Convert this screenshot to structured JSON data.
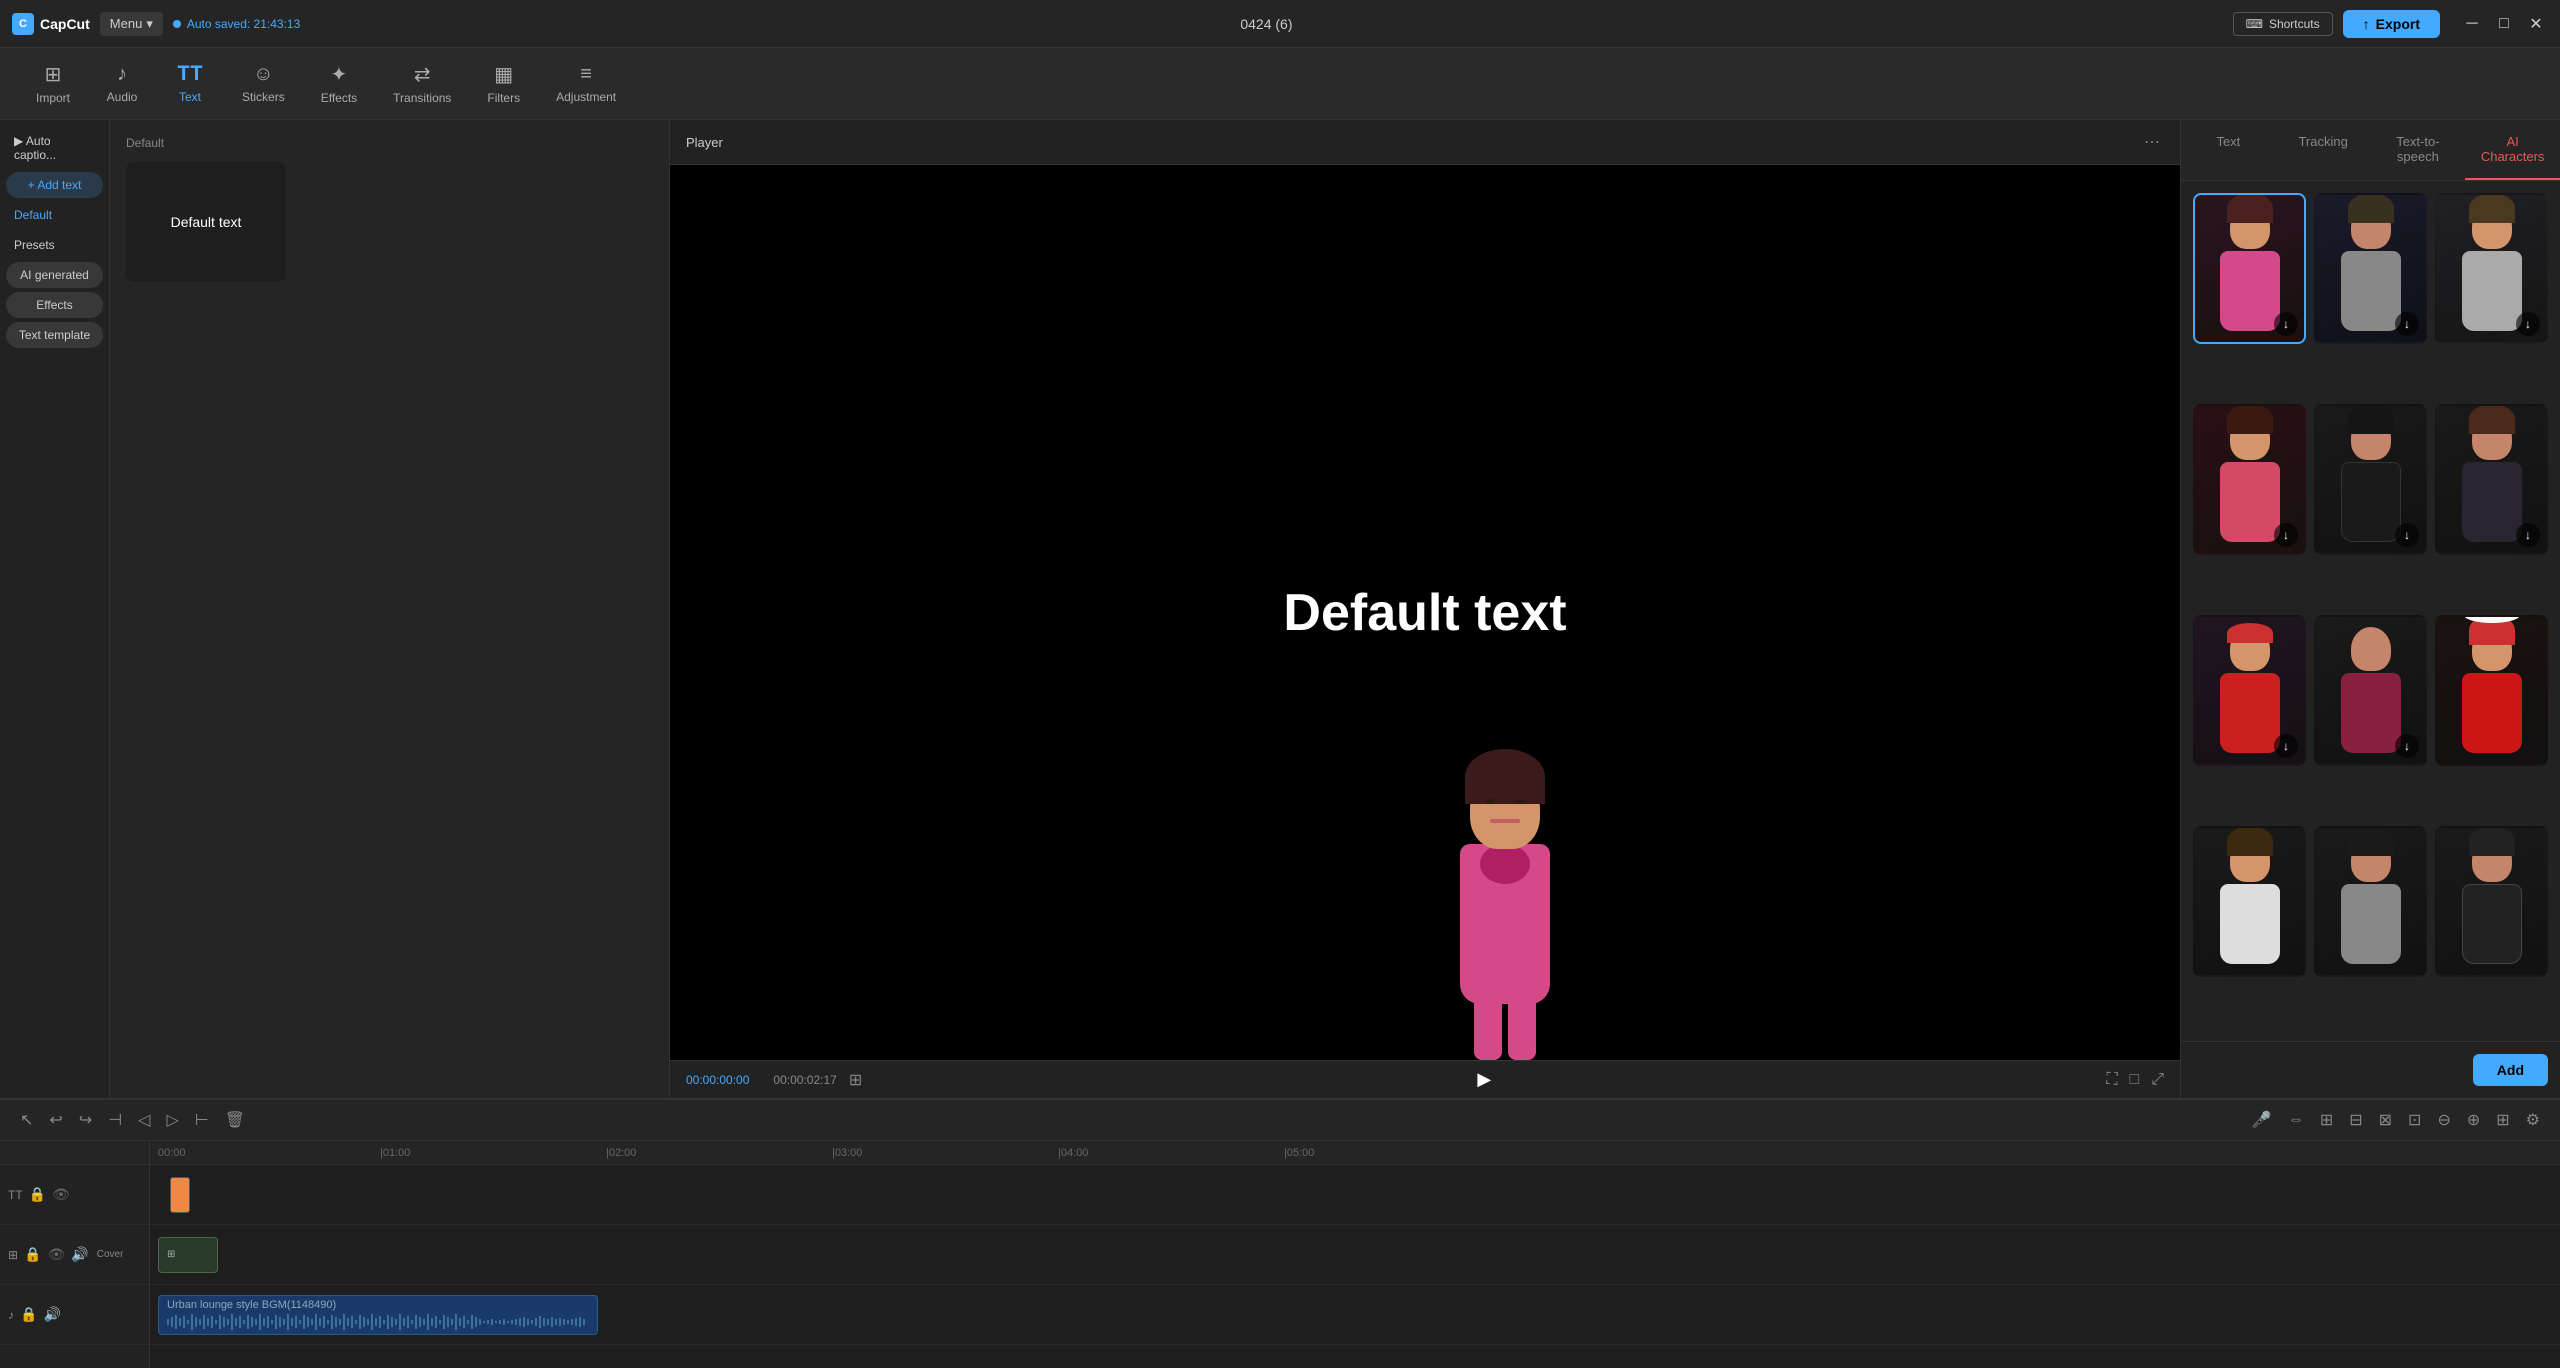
{
  "app": {
    "logo": "CapCut",
    "menu_label": "Menu",
    "autosave": "Auto saved: 21:43:13",
    "project_title": "0424 (6)"
  },
  "topbar": {
    "shortcuts_label": "Shortcuts",
    "export_label": "Export"
  },
  "toolbar": {
    "items": [
      {
        "id": "import",
        "label": "Import",
        "icon": "⊞"
      },
      {
        "id": "audio",
        "label": "Audio",
        "icon": "♪"
      },
      {
        "id": "text",
        "label": "Text",
        "icon": "T",
        "active": true
      },
      {
        "id": "stickers",
        "label": "Stickers",
        "icon": "☺"
      },
      {
        "id": "effects",
        "label": "Effects",
        "icon": "✦"
      },
      {
        "id": "transitions",
        "label": "Transitions",
        "icon": "⇄"
      },
      {
        "id": "filters",
        "label": "Filters",
        "icon": "▦"
      },
      {
        "id": "adjustment",
        "label": "Adjustment",
        "icon": "≡"
      }
    ]
  },
  "left_panel": {
    "items": [
      {
        "id": "auto-caption",
        "label": "▶ Auto captio...",
        "type": "link"
      },
      {
        "id": "add-text",
        "label": "+ Add text",
        "type": "pill",
        "active": true
      },
      {
        "id": "default",
        "label": "Default",
        "type": "plain",
        "active": true
      },
      {
        "id": "presets",
        "label": "Presets",
        "type": "plain"
      },
      {
        "id": "ai-generated",
        "label": "AI generated",
        "type": "pill"
      },
      {
        "id": "effects",
        "label": "Effects",
        "type": "pill"
      },
      {
        "id": "text-template",
        "label": "Text template",
        "type": "pill"
      }
    ]
  },
  "text_panel": {
    "section": "Default",
    "card_label": "Default text"
  },
  "player": {
    "title": "Player",
    "time_current": "00:00:00:00",
    "time_total": "00:00:02:17",
    "overlay_text": "Default text"
  },
  "right_panel": {
    "tabs": [
      {
        "id": "text",
        "label": "Text"
      },
      {
        "id": "tracking",
        "label": "Tracking"
      },
      {
        "id": "text-to-speech",
        "label": "Text-to-speech"
      },
      {
        "id": "ai-characters",
        "label": "AI Characters",
        "active": true
      }
    ],
    "add_button": "Add",
    "characters": [
      {
        "id": "char-1",
        "selected": true,
        "bg": "#3a1a2a",
        "emoji": "👩"
      },
      {
        "id": "char-2",
        "selected": false,
        "bg": "#2a2a3a",
        "emoji": "👩"
      },
      {
        "id": "char-3",
        "selected": false,
        "bg": "#252530",
        "emoji": "👩"
      },
      {
        "id": "char-4",
        "selected": false,
        "bg": "#3a1a2a",
        "emoji": "👩"
      },
      {
        "id": "char-5",
        "selected": false,
        "bg": "#2a2a2a",
        "emoji": "👩"
      },
      {
        "id": "char-6",
        "selected": false,
        "bg": "#1a1a1a",
        "emoji": "👩"
      },
      {
        "id": "char-7",
        "selected": false,
        "bg": "#2a1a1a",
        "emoji": "👩"
      },
      {
        "id": "char-8",
        "selected": false,
        "bg": "#252525",
        "emoji": "👩"
      },
      {
        "id": "char-9",
        "selected": false,
        "bg": "#2a2a2a",
        "emoji": "🧑"
      },
      {
        "id": "char-10",
        "selected": false,
        "bg": "#1a1a1a",
        "emoji": "👩"
      },
      {
        "id": "char-11",
        "selected": false,
        "bg": "#282828",
        "emoji": "🧑"
      },
      {
        "id": "char-12",
        "selected": false,
        "bg": "#222222",
        "emoji": "🧑"
      }
    ]
  },
  "timeline": {
    "tracks": [
      {
        "id": "text-track",
        "icons": [
          "TT",
          "🔒",
          "👁"
        ]
      },
      {
        "id": "cover-track",
        "icons": [
          "⊞",
          "🔒",
          "👁",
          "🔊"
        ],
        "has_cover": true
      },
      {
        "id": "audio-track",
        "icons": [
          "♪",
          "🔒",
          "🔊"
        ],
        "clip_label": "Urban lounge style BGM(1148490)"
      }
    ],
    "time_marks": [
      "00:00",
      "|01:00",
      "|02:00",
      "|03:00",
      "|04:00",
      "|05:00"
    ]
  },
  "timeline_toolbar": {
    "tools": [
      "↖",
      "↩",
      "↪",
      "⊣",
      "◁",
      "▷",
      "⊢",
      "🗑"
    ]
  }
}
